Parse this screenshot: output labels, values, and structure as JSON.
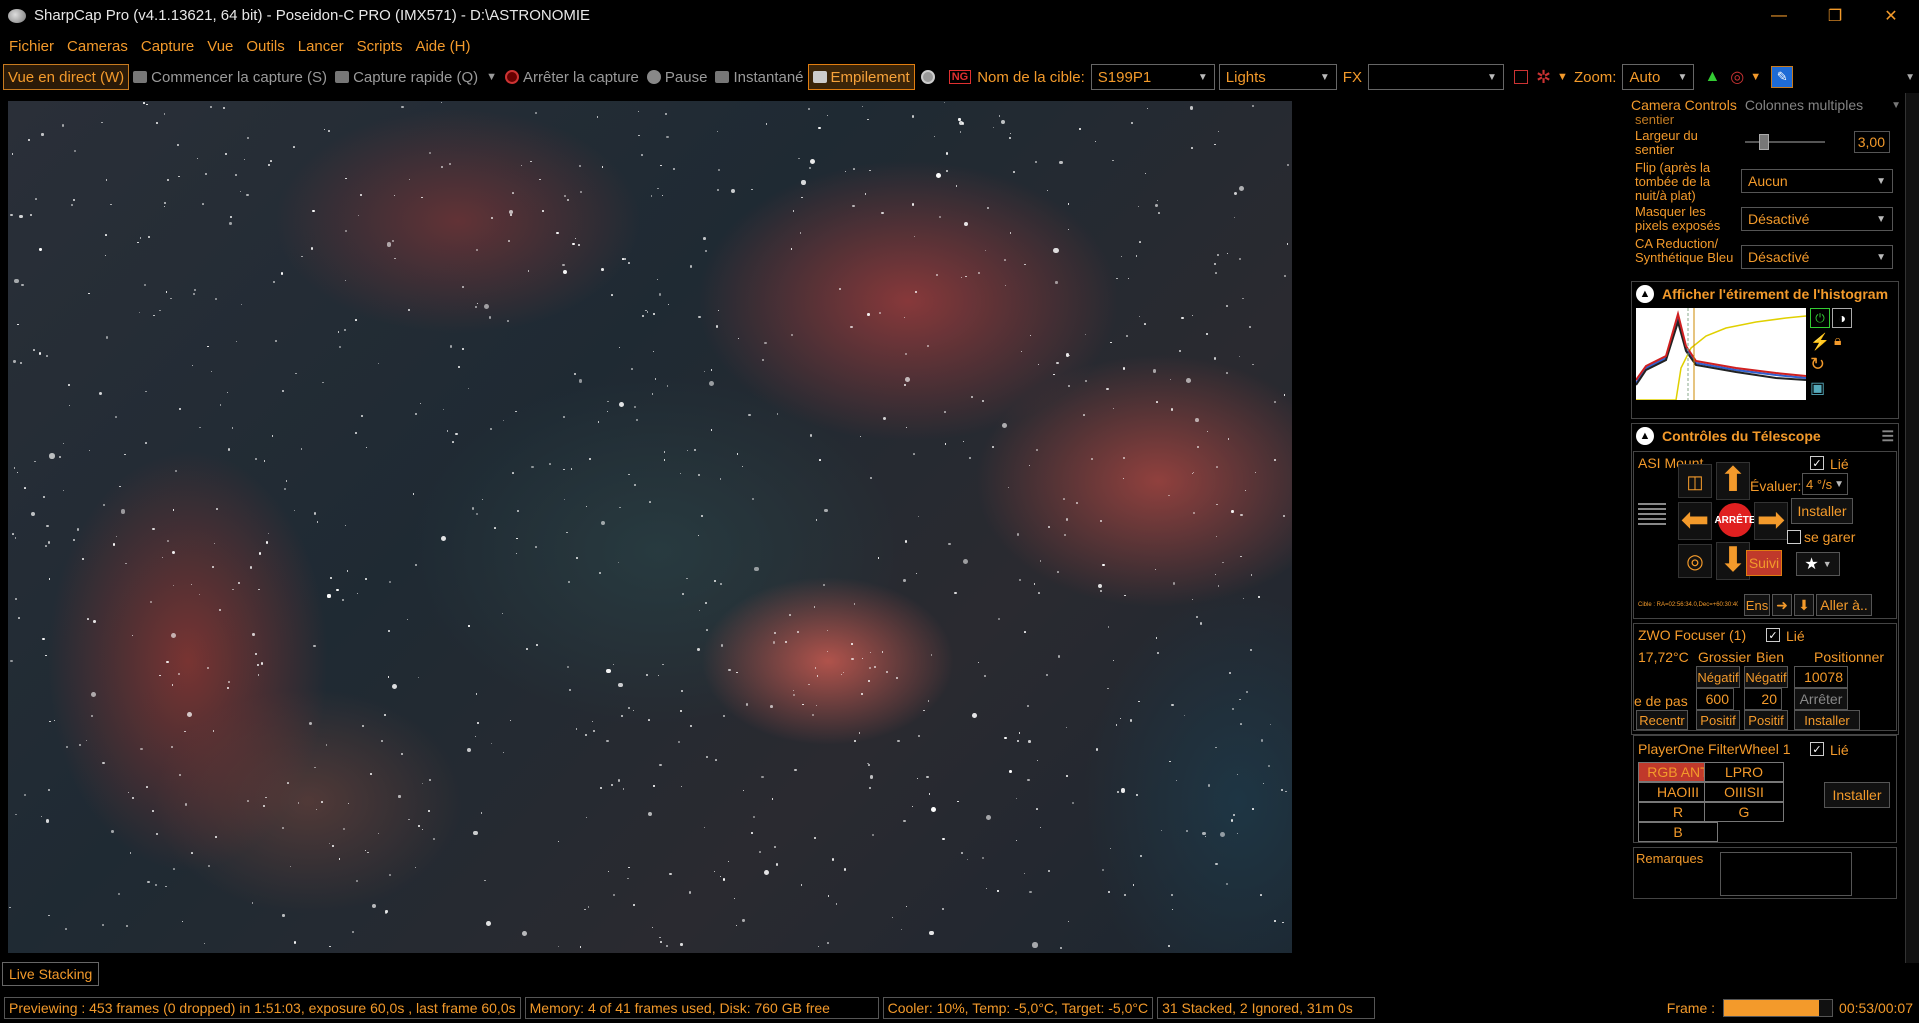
{
  "window": {
    "title": "SharpCap Pro (v4.1.13621, 64 bit) - Poseidon-C PRO (IMX571) - D:\\ASTRONOMIE",
    "minimize": "—",
    "maximize": "❐",
    "close": "✕"
  },
  "menu": [
    "Fichier",
    "Cameras",
    "Capture",
    "Vue",
    "Outils",
    "Lancer",
    "Scripts",
    "Aide (H)"
  ],
  "toolbar": {
    "live_view": "Vue en direct (W)",
    "start_capture": "Commencer la capture (S)",
    "quick_capture": "Capture rapide (Q)",
    "stop_capture": "Arrêter la capture",
    "pause": "Pause",
    "snapshot": "Instantané",
    "stacking": "Empilement",
    "target_label": "Nom de la cible:",
    "target_value": "S199P1",
    "frame_type": "Lights",
    "fx_label": "FX",
    "fx_value": "",
    "zoom_label": "Zoom:",
    "zoom_value": "Auto"
  },
  "camera_controls": {
    "tab": "Camera Controls",
    "multi_columns": "Colonnes multiples",
    "cut_label": "sentier",
    "width_label": "Largeur du sentier",
    "width_value": "3,00",
    "flip_label": "Flip (après la tombée de la nuit/à plat)",
    "flip_value": "Aucun",
    "mask_label": "Masquer les pixels exposés",
    "mask_value": "Désactivé",
    "ca_label": "CA Reduction/ Synthétique Bleu",
    "ca_value": "Désactivé"
  },
  "histogram": {
    "title": "Afficher l'étirement de l'histogram"
  },
  "telescope": {
    "title": "Contrôles du Télescope",
    "mount": "ASI Mount",
    "linked": "Lié",
    "rate_label": "Évaluer:",
    "rate_value": "4 °/s",
    "stop": "ARRÊTE",
    "install": "Installer",
    "park": "se garer",
    "track": "Suivi",
    "ens": "Ens",
    "goto": "Aller à..",
    "coords": "Cible : RA=02:56:34.0,Dec=+60:30:40"
  },
  "focuser": {
    "title": "ZWO Focuser (1)",
    "linked": "Lié",
    "temp": "17,72°C",
    "coarse": "Grossier",
    "fine": "Bien",
    "position_label": "Positionner",
    "negative": "Négatif",
    "position_value": "10078",
    "step_label": "e de pas",
    "coarse_step": "600",
    "fine_step": "20",
    "stop": "Arrêter",
    "recenter": "Recentr",
    "positive": "Positif",
    "install": "Installer"
  },
  "filterwheel": {
    "title": "PlayerOne FilterWheel 1",
    "linked": "Lié",
    "filters": [
      "RGB ANT",
      "LPRO",
      "HAOIII",
      "OIIISII",
      "R",
      "G",
      "B"
    ],
    "install": "Installer"
  },
  "notes": {
    "label": "Remarques"
  },
  "bottom_tab": "Live Stacking",
  "status": {
    "preview": "Previewing : 453 frames (0 dropped) in 1:51:03, exposure 60,0s , last frame 60,0s",
    "memory": "Memory: 4 of 41 frames used, Disk: 760 GB free",
    "cooler": "Cooler: 10%, Temp: -5,0°C, Target: -5,0°C",
    "stack": "31 Stacked, 2 Ignored, 31m 0s",
    "frame_label": "Frame :",
    "frame_time": "00:53/00:07",
    "frame_progress": 0.88
  },
  "colors": {
    "accent": "#f39a2b",
    "background": "#000000"
  }
}
